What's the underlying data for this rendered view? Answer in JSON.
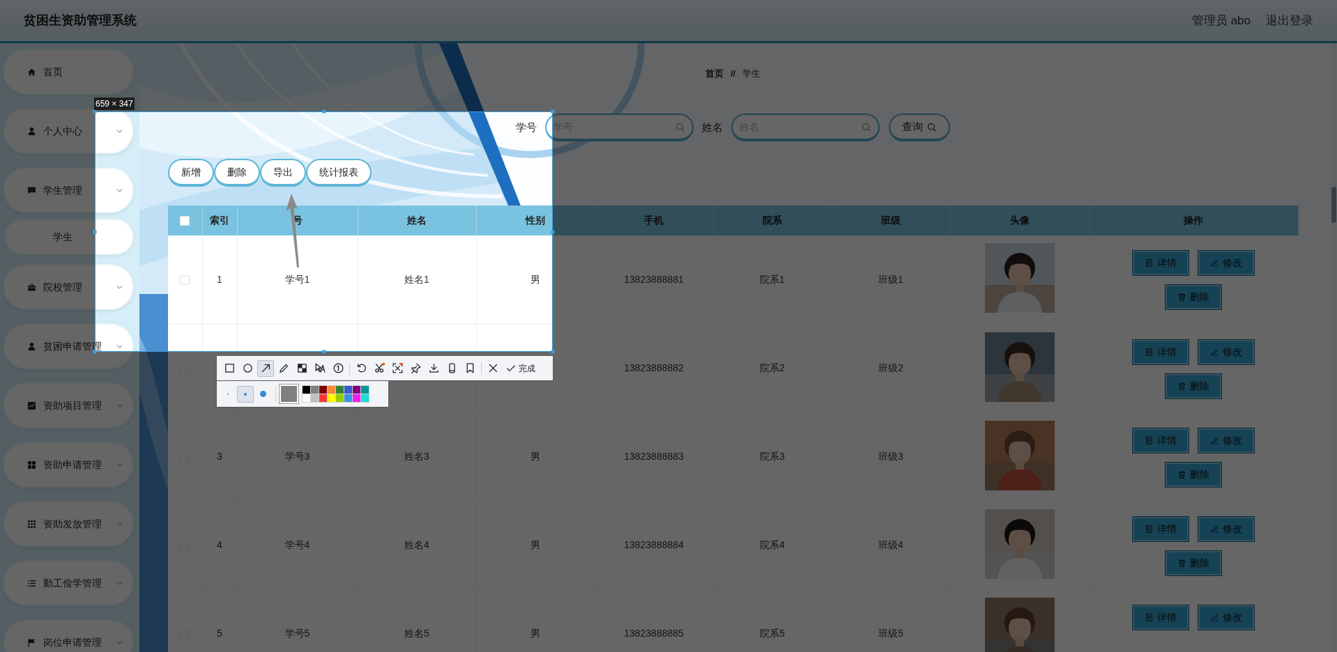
{
  "header": {
    "title": "贫困生资助管理系统",
    "user": "管理员 abo",
    "logout": "退出登录"
  },
  "sidebar": {
    "items": [
      {
        "label": "首页",
        "kind": "link"
      },
      {
        "label": "个人中心",
        "kind": "menu"
      },
      {
        "label": "学生管理",
        "kind": "menu",
        "children": [
          {
            "label": "学生"
          }
        ]
      },
      {
        "label": "院校管理",
        "kind": "menu"
      },
      {
        "label": "贫困申请管理",
        "kind": "menu"
      },
      {
        "label": "资助项目管理",
        "kind": "menu"
      },
      {
        "label": "资助申请管理",
        "kind": "menu"
      },
      {
        "label": "资助发放管理",
        "kind": "menu"
      },
      {
        "label": "勤工俭学管理",
        "kind": "menu"
      },
      {
        "label": "岗位申请管理",
        "kind": "menu"
      }
    ]
  },
  "breadcrumb": {
    "items": [
      "首页",
      "学生"
    ],
    "separator": "//"
  },
  "search": {
    "fields": [
      {
        "label": "学号",
        "placeholder": "学号"
      },
      {
        "label": "姓名",
        "placeholder": "姓名"
      }
    ],
    "button": "查询"
  },
  "actions": [
    "新增",
    "删除",
    "导出",
    "统计报表"
  ],
  "table": {
    "select_all": {
      "checked": false
    },
    "columns": [
      "索引",
      "号",
      "姓名",
      "性别",
      "手机",
      "院系",
      "班级",
      "头像",
      "操作"
    ],
    "rows": [
      {
        "checked": false,
        "index": "1",
        "student_id": "学号1",
        "name": "姓名1",
        "gender": "男",
        "phone": "13823888881",
        "department": "院系1",
        "class": "班级1",
        "avatar": {
          "kind": "picture"
        },
        "actions": [
          "详情",
          "修改",
          "删除"
        ]
      },
      {
        "checked": false,
        "phone": "13823888882",
        "department": "院系2",
        "class": "班级2",
        "avatar": {
          "kind": "picture"
        },
        "actions": [
          "详情",
          "修改",
          "删除"
        ]
      },
      {
        "checked": false,
        "index": "3",
        "student_id": "学号3",
        "name": "姓名3",
        "gender": "男",
        "phone": "13823888883",
        "department": "院系3",
        "class": "班级3",
        "avatar": {
          "kind": "picture"
        },
        "actions": [
          "详情",
          "修改",
          "删除"
        ]
      },
      {
        "checked": false,
        "index": "4",
        "student_id": "学号4",
        "name": "姓名4",
        "gender": "男",
        "phone": "13823888884",
        "department": "院系4",
        "class": "班级4",
        "avatar": {
          "kind": "picture"
        },
        "actions": [
          "详情",
          "修改",
          "删除"
        ]
      },
      {
        "checked": false,
        "index": "5",
        "student_id": "学号5",
        "name": "姓名5",
        "gender": "男",
        "phone": "13823888885",
        "department": "院系5",
        "class": "班级5",
        "avatar": {
          "kind": "picture"
        },
        "actions": [
          "详情",
          "修改"
        ]
      }
    ]
  },
  "capture": {
    "size_label": "659 × 347",
    "tools": [
      {
        "selected": false
      },
      {
        "selected": false
      },
      {
        "selected": true
      },
      {
        "selected": false
      },
      {
        "selected": false
      },
      {
        "selected": false
      },
      {
        "selected": false
      },
      {
        "selected": false
      },
      {
        "selected": false
      },
      {
        "selected": false
      },
      {
        "selected": false
      },
      {
        "selected": false
      },
      {
        "selected": false
      },
      {
        "selected": false
      },
      {
        "selected": false
      }
    ],
    "done": "完成",
    "pen_sizes": [
      {
        "selected": false
      },
      {
        "selected": true
      },
      {
        "selected": false
      }
    ],
    "current_color": {
      "color": "#7f7f7f"
    },
    "colors": [
      {
        "color": "#000000"
      },
      {
        "color": "#808080"
      },
      {
        "color": "#800000"
      },
      {
        "color": "#f7883a"
      },
      {
        "color": "#308430"
      },
      {
        "color": "#385ad3"
      },
      {
        "color": "#800080"
      },
      {
        "color": "#009999"
      },
      {
        "color": "#ffffff"
      },
      {
        "color": "#c0c0c0"
      },
      {
        "color": "#fb3838"
      },
      {
        "color": "#ffff00"
      },
      {
        "color": "#99cc00"
      },
      {
        "color": "#3895e0"
      },
      {
        "color": "#f31bf3"
      },
      {
        "color": "#16dcdc"
      }
    ]
  }
}
